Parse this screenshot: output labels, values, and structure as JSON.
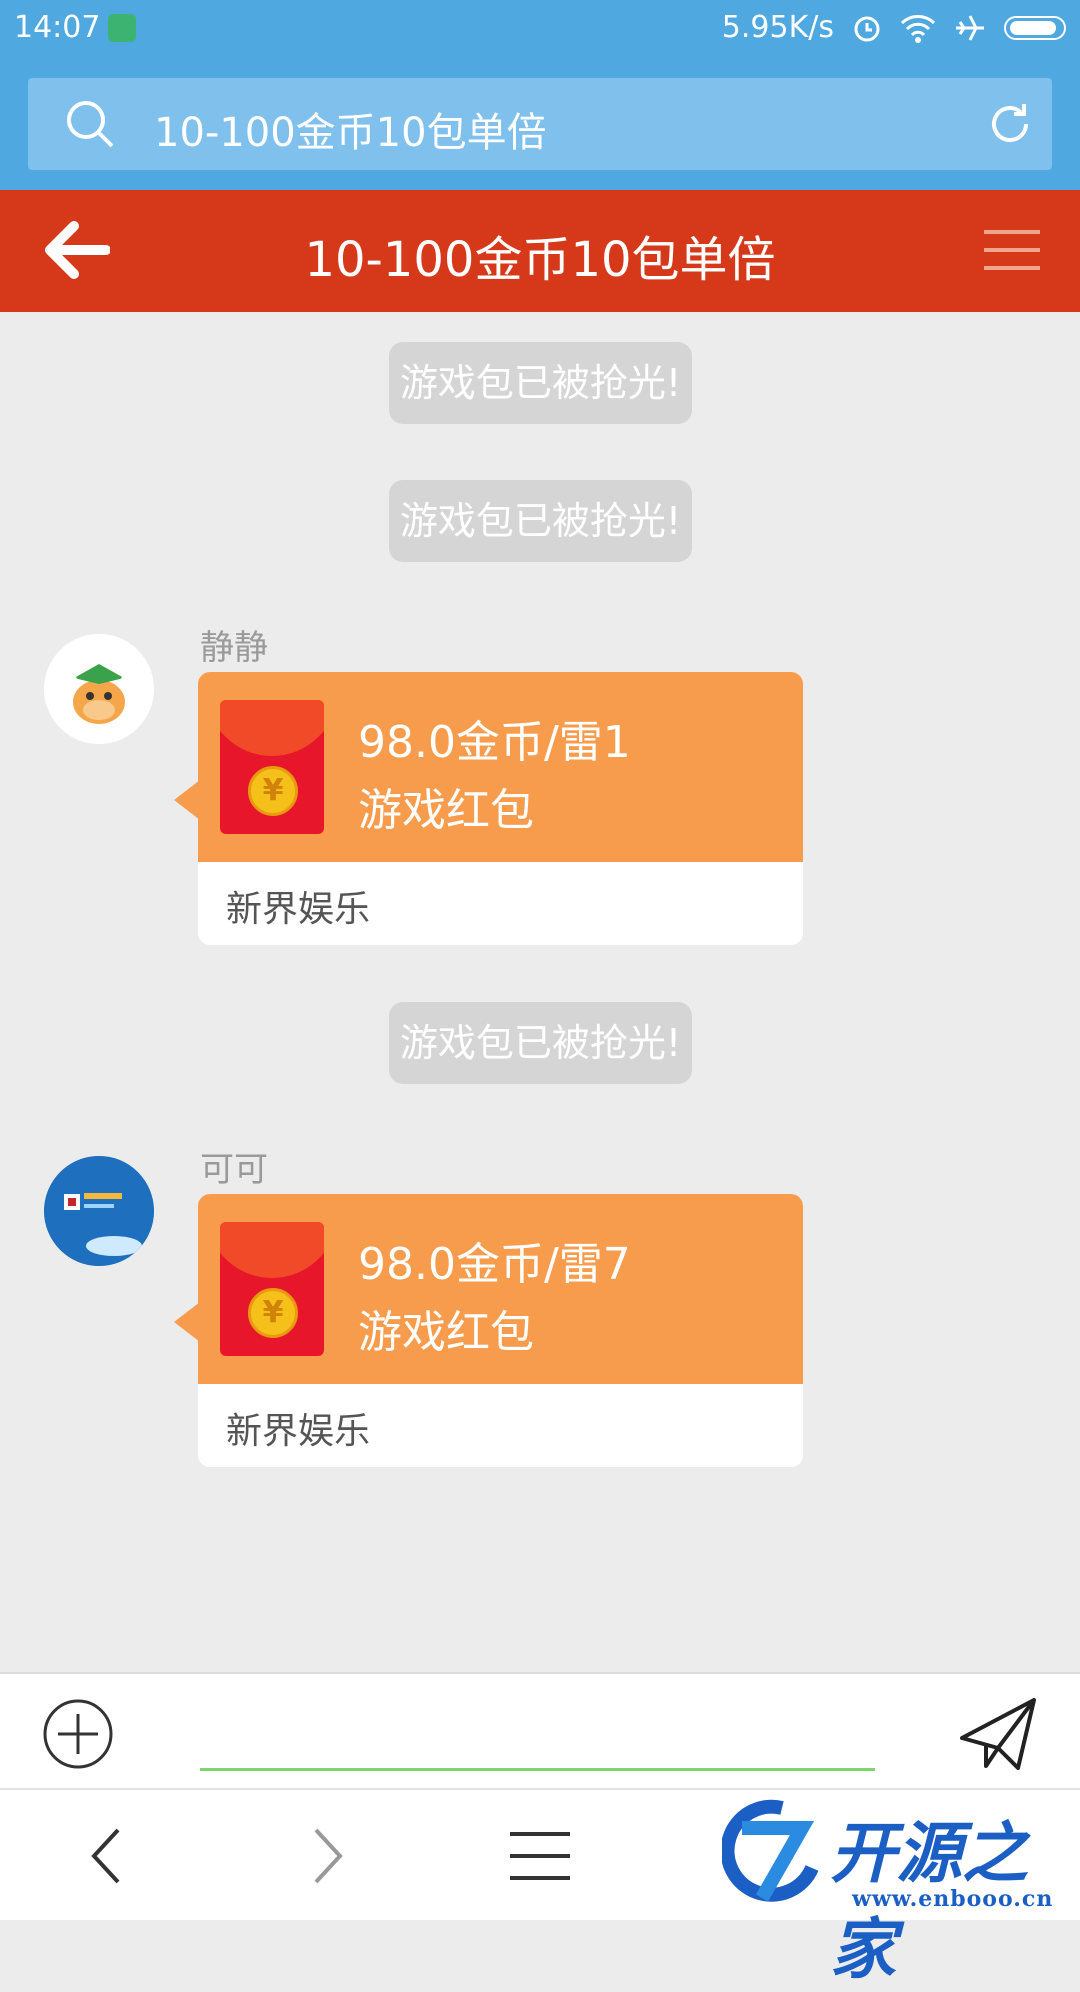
{
  "status_bar": {
    "time": "14:07",
    "net_speed": "5.95K/s"
  },
  "url_bar": {
    "query": "10-100金币10包单倍"
  },
  "header": {
    "title": "10-100金币10包单倍"
  },
  "messages": {
    "sys_1": "游戏包已被抢光!",
    "sys_2": "游戏包已被抢光!",
    "sys_3": "游戏包已被抢光!",
    "m1": {
      "sender": "静静",
      "line1": "98.0金币/雷1",
      "line2": "游戏红包",
      "footer": "新界娱乐"
    },
    "m2": {
      "sender": "可可",
      "line1": "98.0金币/雷7",
      "line2": "游戏红包",
      "footer": "新界娱乐"
    }
  },
  "coin_symbol": "¥",
  "watermark": {
    "title": "开源之家",
    "url": "www.enbooo.cn"
  },
  "icons": {
    "search": "search-icon",
    "refresh": "refresh-icon",
    "back": "back-arrow-icon",
    "menu": "menu-icon",
    "plus": "add-circle-icon",
    "send": "send-icon",
    "nav_back": "chevron-left-icon",
    "nav_forward": "chevron-right-icon",
    "nav_menu": "hamburger-icon"
  },
  "colors": {
    "status": "#4fa8e0",
    "header": "#d6391a",
    "card": "#f79c4c",
    "input_line": "#7cd46a"
  }
}
